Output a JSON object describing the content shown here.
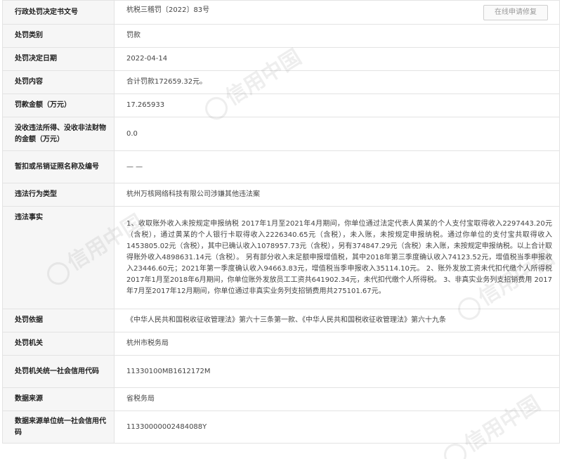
{
  "rows": {
    "doc_number": {
      "label": "行政处罚决定书文号",
      "value": "杭税三稽罚〔2022〕83号",
      "button": "在线申请修复"
    },
    "penalty_type": {
      "label": "处罚类别",
      "value": "罚款"
    },
    "decision_date": {
      "label": "处罚决定日期",
      "value": "2022-04-14"
    },
    "content": {
      "label": "处罚内容",
      "value": "合计罚款172659.32元。"
    },
    "fine_amount": {
      "label": "罚款金额（万元）",
      "value": "17.265933"
    },
    "confiscated": {
      "label": "没收违法所得、没收非法财物的金额（万元）",
      "value": "0.0"
    },
    "license": {
      "label": "暂扣或吊销证照名称及编号",
      "value": "— —"
    },
    "violation_type": {
      "label": "违法行为类型",
      "value": "杭州万核网络科技有限公司涉嫌其他违法案"
    },
    "violation_facts": {
      "label": "违法事实",
      "value": "1、收取账外收入未按规定申报纳税 2017年1月至2021年4月期间，你单位通过法定代表人黄某的个人支付宝取得收入2297443.20元（含税），通过黄某的个人银行卡取得收入2226340.65元（含税），未入账，未按规定申报纳税。通过你单位的支付宝共取得收入1453805.02元（含税），其中已确认收入1078957.73元（含税），另有374847.29元（含税）未入账，未按规定申报纳税。以上合计取得账外收入4898631.14元（含税）。 另有部分收入未足额申报增值税，其中2018年第三季度确认收入74123.52元，增值税当季申报收入23446.60元；2021年第一季度确认收入94663.83元，增值税当季申报收入35114.10元。 2、账外发放工资未代扣代缴个人所得税 2017年1月至2018年6月期间，你单位账外发放员工工资共641902.34元，未代扣代缴个人所得税。 3、非真实业务列支招销费用 2017年7月至2017年12月期间，你单位通过非真实业务列支招销费用共275101.67元。"
    },
    "basis": {
      "label": "处罚依据",
      "value": "《中华人民共和国税收征收管理法》第六十三条第一款、《中华人民共和国税收征收管理法》第六十九条"
    },
    "authority": {
      "label": "处罚机关",
      "value": "杭州市税务局"
    },
    "authority_code": {
      "label": "处罚机关统一社会信用代码",
      "value": "11330100MB1612172M"
    },
    "source": {
      "label": "数据来源",
      "value": "省税务局"
    },
    "source_code": {
      "label": "数据来源单位统一社会信用代码",
      "value": "11330000002484088Y"
    }
  },
  "watermark_text": "信用中国"
}
